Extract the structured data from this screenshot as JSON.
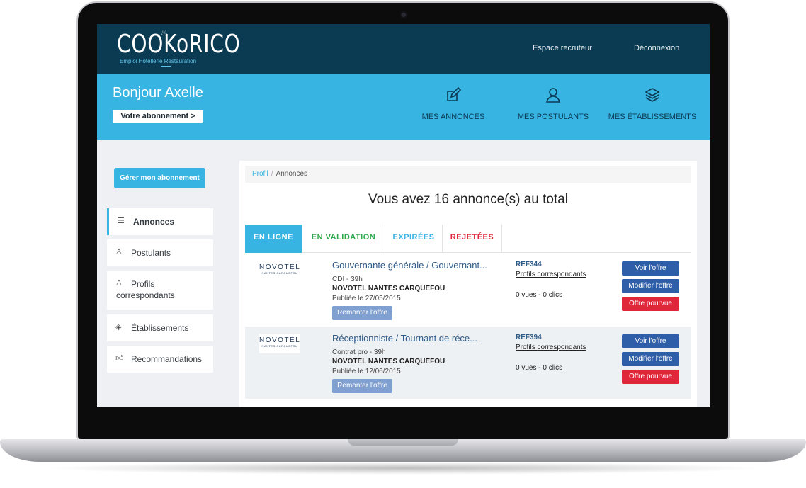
{
  "header": {
    "logo_text": "COOKoRICO",
    "logo_tagline": "Emploi Hôtellerie Restauration",
    "links": [
      "Espace recruteur",
      "Déconnexion"
    ]
  },
  "hero": {
    "greeting": "Bonjour Axelle",
    "subscription_button": "Votre abonnement >",
    "nav": [
      {
        "label": "MES ANNONCES",
        "icon": "edit-icon"
      },
      {
        "label": "MES POSTULANTS",
        "icon": "user-icon"
      },
      {
        "label": "MES ÉTABLISSEMENTS",
        "icon": "layers-icon"
      }
    ]
  },
  "sidebar": {
    "manage_button": "Gérer mon abonnement",
    "items": [
      {
        "label": "Annonces",
        "icon": "list-icon",
        "active": true
      },
      {
        "label": "Postulants",
        "icon": "user-icon"
      },
      {
        "label_line1": "Profils",
        "label_line2": "correspondants",
        "icon": "user-icon"
      },
      {
        "label": "Établissements",
        "icon": "layers-icon"
      },
      {
        "label": "Recommandations",
        "icon": "thumbs-up-icon"
      }
    ]
  },
  "main": {
    "breadcrumb": [
      "Profil",
      "Annonces"
    ],
    "headline": "Vous avez 16 annonce(s) au total",
    "tabs": [
      {
        "label": "EN LIGNE",
        "color": "#ffffff",
        "active": true
      },
      {
        "label": "EN VALIDATION",
        "color": "#2aa84a"
      },
      {
        "label": "EXPIRÉES",
        "color": "#37b4e2"
      },
      {
        "label": "REJETÉES",
        "color": "#e0273a"
      }
    ],
    "listings": [
      {
        "brand": "NOVOTEL",
        "brand_tag": "NANTES CARQUEFOU",
        "title": "Gouvernante générale / Gouvernant...",
        "contract": "CDI - 39h",
        "company": "NOVOTEL NANTES CARQUEFOU",
        "published": "Publiée le 27/05/2015",
        "repost": "Remonter l'offre",
        "ref": "REF344",
        "profiles_link": "Profils correspondants",
        "stats": "0 vues - 0 clics",
        "view": "Voir l'offre",
        "edit": "Modifier l'offre",
        "filled": "Offre pourvue"
      },
      {
        "brand": "NOVOTEL",
        "brand_tag": "NANTES CARQUEFOU",
        "title": "Réceptionniste / Tournant de réce...",
        "contract": "Contrat pro - 39h",
        "company": "NOVOTEL NANTES CARQUEFOU",
        "published": "Publiée le 12/06/2015",
        "repost": "Remonter l'offre",
        "ref": "REF394",
        "profiles_link": "Profils correspondants",
        "stats": "0 vues - 0 clics",
        "view": "Voir l'offre",
        "edit": "Modifier l'offre",
        "filled": "Offre pourvue"
      }
    ]
  },
  "colors": {
    "topbar": "#0a3b52",
    "accent": "#37b4e2",
    "primary_button": "#2f5ea8",
    "danger_button": "#e0273a"
  }
}
